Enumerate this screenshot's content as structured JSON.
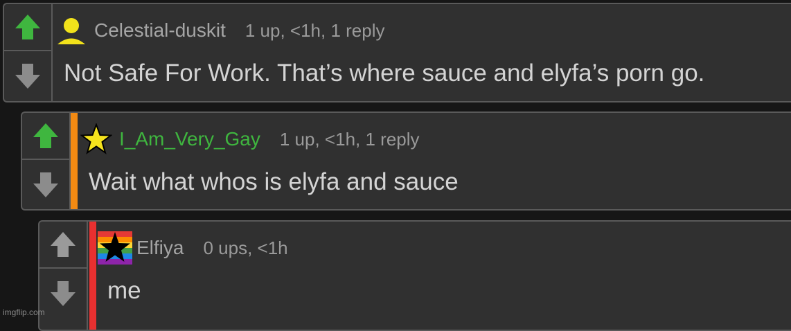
{
  "comments": [
    {
      "username": "Celestial-duskit",
      "meta": "1 up, <1h, 1 reply",
      "text": "Not Safe For Work. That’s where sauce and elyfa’s porn go.",
      "username_color": "#a5a5a5",
      "upvote_color": "#3fb63f",
      "stripe_color": null,
      "avatar_icon": "user-silhouette-icon"
    },
    {
      "username": "I_Am_Very_Gay",
      "meta": "1 up, <1h, 1 reply",
      "text": "Wait what whos is elyfa and sauce",
      "username_color": "#3fb63f",
      "upvote_color": "#3fb63f",
      "stripe_color": "#f28a13",
      "avatar_icon": "yellow-star-icon"
    },
    {
      "username": "Elfiya",
      "meta": "0 ups, <1h",
      "text": "me",
      "username_color": "#a5a5a5",
      "upvote_color": "#9a9a9a",
      "stripe_color": "#e83030",
      "avatar_icon": "rainbow-flag-star-icon"
    }
  ],
  "watermark": "imgflip.com"
}
